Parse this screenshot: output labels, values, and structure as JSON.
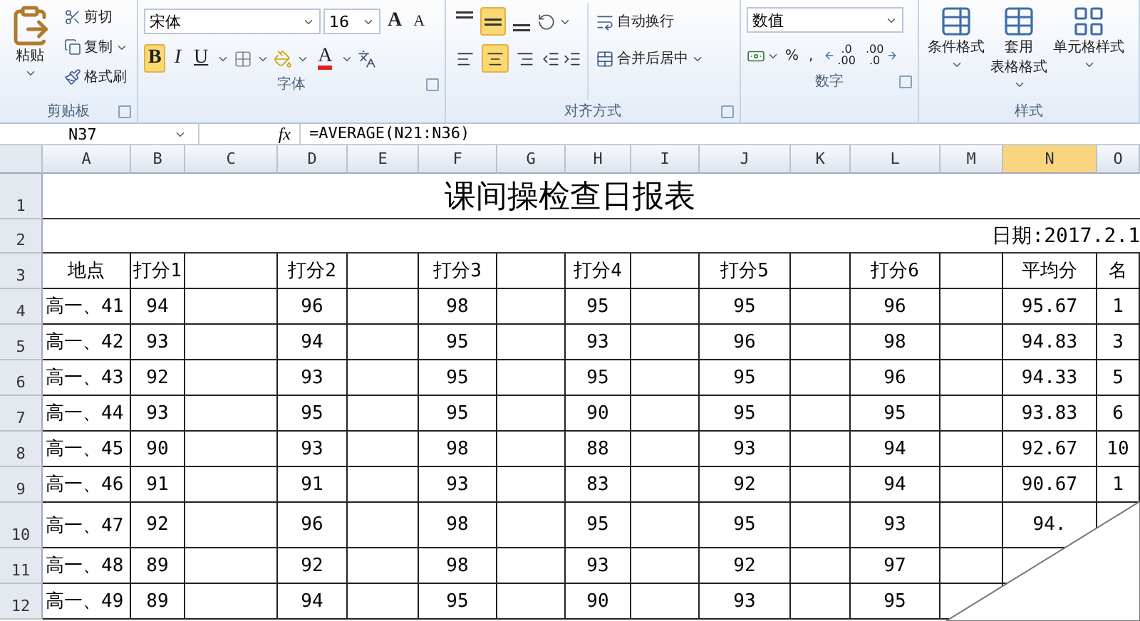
{
  "ribbon": {
    "groups": [
      {
        "kind": "clipboard",
        "label": "剪贴板",
        "paste": "粘贴",
        "items": [
          {
            "label": "剪切",
            "dropdown": false
          },
          {
            "label": "复制",
            "dropdown": true
          },
          {
            "label": "格式刷",
            "dropdown": false
          }
        ]
      },
      {
        "kind": "font",
        "label": "字体",
        "font_name": "宋体",
        "font_size": "16",
        "grow": "A",
        "shrink": "A",
        "styles": [
          {
            "label": "B",
            "selected": true
          },
          {
            "label": "I",
            "selected": false
          },
          {
            "label": "U",
            "selected": false
          }
        ],
        "font_color": "A"
      },
      {
        "kind": "alignment",
        "label": "对齐方式",
        "vertical_align": [
          {
            "selected": false
          },
          {
            "selected": true
          },
          {
            "selected": false
          }
        ],
        "horizontal_align": [
          {
            "selected": false
          },
          {
            "selected": true
          },
          {
            "selected": false
          }
        ],
        "wrap_text": "自动换行",
        "merge": "合并后居中"
      },
      {
        "kind": "number",
        "label": "数字",
        "format": "数值",
        "percent": "%",
        "comma": ",",
        "decimals": [
          {
            "top": ".0",
            "bottom": ".00"
          },
          {
            "top": ".00",
            "bottom": ".0"
          }
        ]
      },
      {
        "kind": "styles",
        "label": "样式",
        "buttons": [
          {
            "lines": [
              "条件格式"
            ]
          },
          {
            "lines": [
              "套用",
              "表格格式"
            ]
          },
          {
            "lines": [
              "单元格样式"
            ]
          }
        ]
      }
    ]
  },
  "formula_bar": {
    "name_box": "N37",
    "function_button": "fx",
    "formula": "=AVERAGE(N21:N36)"
  },
  "sheet": {
    "columns": [
      {
        "letter": "A",
        "selected": false
      },
      {
        "letter": "B",
        "selected": false
      },
      {
        "letter": "C",
        "selected": false
      },
      {
        "letter": "D",
        "selected": false
      },
      {
        "letter": "E",
        "selected": false
      },
      {
        "letter": "F",
        "selected": false
      },
      {
        "letter": "G",
        "selected": false
      },
      {
        "letter": "H",
        "selected": false
      },
      {
        "letter": "I",
        "selected": false
      },
      {
        "letter": "J",
        "selected": false
      },
      {
        "letter": "K",
        "selected": false
      },
      {
        "letter": "L",
        "selected": false
      },
      {
        "letter": "M",
        "selected": false
      },
      {
        "letter": "N",
        "selected": true
      },
      {
        "letter": "O",
        "selected": false
      }
    ],
    "rows": [
      {
        "number": "1",
        "kind": "title",
        "text": "课间操检查日报表"
      },
      {
        "number": "2",
        "kind": "date",
        "text": "日期:2017.2.1"
      },
      {
        "number": "3",
        "kind": "header",
        "cells": {
          "A": "地点",
          "B": "打分1",
          "D": "打分2",
          "F": "打分3",
          "H": "打分4",
          "J": "打分5",
          "L": "打分6",
          "N": "平均分",
          "O": "名"
        }
      },
      {
        "number": "4",
        "kind": "data",
        "cells": {
          "A": "高一、41",
          "B": "94",
          "D": "96",
          "F": "98",
          "H": "95",
          "J": "95",
          "L": "96",
          "N": "95.67",
          "O": "1"
        }
      },
      {
        "number": "5",
        "kind": "data",
        "cells": {
          "A": "高一、42",
          "B": "93",
          "D": "94",
          "F": "95",
          "H": "93",
          "J": "96",
          "L": "98",
          "N": "94.83",
          "O": "3"
        }
      },
      {
        "number": "6",
        "kind": "data",
        "cells": {
          "A": "高一、43",
          "B": "92",
          "D": "93",
          "F": "95",
          "H": "95",
          "J": "95",
          "L": "96",
          "N": "94.33",
          "O": "5"
        }
      },
      {
        "number": "7",
        "kind": "data",
        "cells": {
          "A": "高一、44",
          "B": "93",
          "D": "95",
          "F": "95",
          "H": "90",
          "J": "95",
          "L": "95",
          "N": "93.83",
          "O": "6"
        }
      },
      {
        "number": "8",
        "kind": "data",
        "cells": {
          "A": "高一、45",
          "B": "90",
          "D": "93",
          "F": "98",
          "H": "88",
          "J": "93",
          "L": "94",
          "N": "92.67",
          "O": "10"
        }
      },
      {
        "number": "9",
        "kind": "data",
        "cells": {
          "A": "高一、46",
          "B": "91",
          "D": "91",
          "F": "93",
          "H": "83",
          "J": "92",
          "L": "94",
          "N": "90.67",
          "O": "1"
        }
      },
      {
        "number": "10",
        "kind": "data",
        "tall": true,
        "cells": {
          "A": "高一、47",
          "B": "92",
          "D": "96",
          "F": "98",
          "H": "95",
          "J": "95",
          "L": "93",
          "N": "94."
        }
      },
      {
        "number": "11",
        "kind": "data",
        "cells": {
          "A": "高一、48",
          "B": "89",
          "D": "92",
          "F": "98",
          "H": "93",
          "J": "92",
          "L": "97"
        }
      },
      {
        "number": "12",
        "kind": "data",
        "cells": {
          "A": "高一、49",
          "B": "89",
          "D": "94",
          "F": "95",
          "H": "90",
          "J": "93",
          "L": "95"
        }
      }
    ]
  }
}
